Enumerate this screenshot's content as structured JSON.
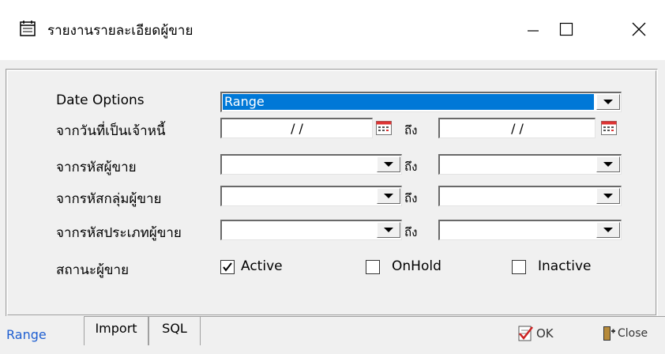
{
  "window": {
    "title": "รายงานรายละเอียดผู้ขาย",
    "icons": {
      "app": "calendar-window-icon",
      "minimize": "minimize-icon",
      "maximize": "maximize-icon",
      "close": "close-icon"
    }
  },
  "form": {
    "date_options": {
      "label": "Date Options",
      "value": "Range"
    },
    "due_date": {
      "label": "จากวันที่เป็นเจ้าหนี้",
      "from": "/ /",
      "to_label": "ถึง",
      "to": "/ /"
    },
    "vendor_code": {
      "label": "จากรหัสผู้ขาย",
      "from": "",
      "to_label": "ถึง",
      "to": ""
    },
    "vendor_group": {
      "label": "จากรหัสกลุ่มผู้ขาย",
      "from": "",
      "to_label": "ถึง",
      "to": ""
    },
    "vendor_type": {
      "label": "จากรหัสประเภทผู้ขาย",
      "from": "",
      "to_label": "ถึง",
      "to": ""
    },
    "status": {
      "label": "สถานะผู้ขาย",
      "options": [
        {
          "label": "Active",
          "checked": true
        },
        {
          "label": "OnHold",
          "checked": false
        },
        {
          "label": "Inactive",
          "checked": false
        }
      ]
    }
  },
  "tabs": [
    "Range",
    "Import",
    "SQL"
  ],
  "buttons": {
    "ok": "OK",
    "close": "Close"
  },
  "colors": {
    "selection": "#0078d7",
    "active_tab_text": "#1f5fd1"
  }
}
